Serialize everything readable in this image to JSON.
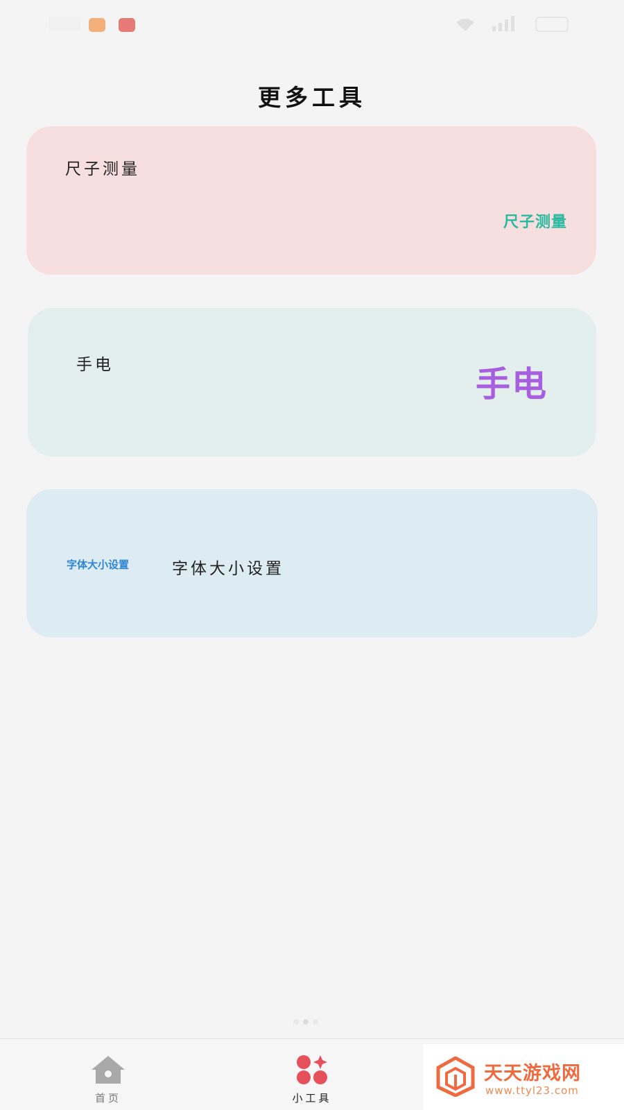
{
  "status_bar": {
    "app_icon_colors": [
      "#f3b07a",
      "#e67a76"
    ]
  },
  "page_title": "更多工具",
  "cards": [
    {
      "label": "尺子测量",
      "logo_text": "尺子测量",
      "background": "#f7dfdf",
      "logo_color": "#2bb9a0"
    },
    {
      "label": "手电",
      "logo_text": "手电",
      "background": "#e2efec",
      "logo_color": "#a75fe0"
    },
    {
      "label": "字体大小设置",
      "logo_text": "字体大小设置",
      "background": "#ddebf2",
      "logo_color": "#2e86d3"
    }
  ],
  "bottom_nav": {
    "items": [
      {
        "label": "首页",
        "icon": "home-icon",
        "active": false
      },
      {
        "label": "小工具",
        "icon": "tools-icon",
        "active": true,
        "accent": "#e6505a"
      }
    ]
  },
  "watermark": {
    "title": "天天游戏网",
    "url": "www.ttyl23.com",
    "color": "#ef6b3f"
  }
}
